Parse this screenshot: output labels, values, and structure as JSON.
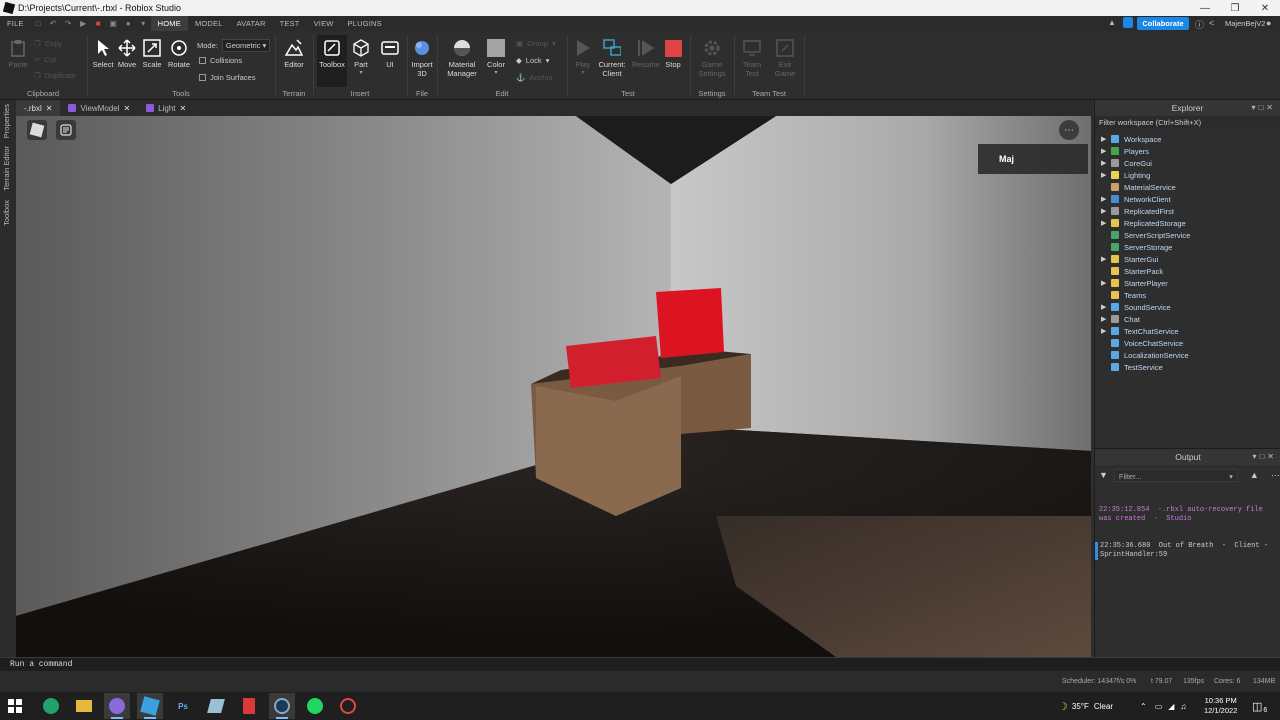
{
  "window": {
    "title": "D:\\Projects\\Current\\-.rbxl - Roblox Studio"
  },
  "menubar": {
    "items": [
      "FILE",
      "HOME",
      "MODEL",
      "AVATAR",
      "TEST",
      "VIEW",
      "PLUGINS"
    ],
    "active": "HOME",
    "collaborate": "Collaborate",
    "username": "MajenBejV2"
  },
  "ribbon": {
    "clipboard": {
      "paste": "Paste",
      "copy": "Copy",
      "cut": "Cut",
      "duplicate": "Duplicate",
      "label": "Clipboard"
    },
    "tools": {
      "select": "Select",
      "move": "Move",
      "scale": "Scale",
      "rotate": "Rotate",
      "mode_label": "Mode:",
      "mode_value": "Geometric",
      "collisions": "Collisions",
      "join_surfaces": "Join Surfaces",
      "label": "Tools"
    },
    "terrain": {
      "editor": "Editor",
      "label": "Terrain"
    },
    "insert": {
      "toolbox": "Toolbox",
      "part": "Part",
      "ui": "UI",
      "label": "Insert"
    },
    "file": {
      "import3d_1": "Import",
      "import3d_2": "3D",
      "label": "File"
    },
    "edit": {
      "material_1": "Material",
      "material_2": "Manager",
      "color": "Color",
      "group": "Group",
      "lock": "Lock",
      "anchor": "Anchor",
      "label": "Edit"
    },
    "test": {
      "play": "Play",
      "current_1": "Current:",
      "current_2": "Client",
      "resume": "Resume",
      "stop": "Stop",
      "label": "Test"
    },
    "settings": {
      "game_1": "Game",
      "game_2": "Settings",
      "label": "Settings"
    },
    "team_test": {
      "team_1": "Team",
      "team_2": "Test",
      "exit_1": "Exit",
      "exit_2": "Game",
      "label": "Team Test"
    }
  },
  "sidebar": {
    "items": [
      "Properties",
      "Terrain Editor",
      "Toolbox"
    ]
  },
  "tabs": [
    {
      "label": "-.rbxl"
    },
    {
      "label": "ViewModel"
    },
    {
      "label": "Light"
    }
  ],
  "viewport": {
    "player_label": "Maj"
  },
  "explorer": {
    "title": "Explorer",
    "filter": "Filter workspace (Ctrl+Shift+X)",
    "items": [
      {
        "name": "Workspace",
        "expand": true,
        "color": "#5aa9e6"
      },
      {
        "name": "Players",
        "expand": true,
        "color": "#4aa34a"
      },
      {
        "name": "CoreGui",
        "expand": true,
        "color": "#9a9a9a"
      },
      {
        "name": "Lighting",
        "expand": true,
        "color": "#e8d44d"
      },
      {
        "name": "MaterialService",
        "expand": false,
        "color": "#c8a06a"
      },
      {
        "name": "NetworkClient",
        "expand": true,
        "color": "#4a8ad8"
      },
      {
        "name": "ReplicatedFirst",
        "expand": true,
        "color": "#9a9a9a"
      },
      {
        "name": "ReplicatedStorage",
        "expand": true,
        "color": "#e8c44d"
      },
      {
        "name": "ServerScriptService",
        "expand": false,
        "color": "#4aa36a"
      },
      {
        "name": "ServerStorage",
        "expand": false,
        "color": "#4aa36a"
      },
      {
        "name": "StarterGui",
        "expand": true,
        "color": "#e8c44d"
      },
      {
        "name": "StarterPack",
        "expand": false,
        "color": "#e8c44d"
      },
      {
        "name": "StarterPlayer",
        "expand": true,
        "color": "#e8c44d"
      },
      {
        "name": "Teams",
        "expand": false,
        "color": "#e8c44d"
      },
      {
        "name": "SoundService",
        "expand": true,
        "color": "#5aa9e6"
      },
      {
        "name": "Chat",
        "expand": true,
        "color": "#9a9a9a"
      },
      {
        "name": "TextChatService",
        "expand": true,
        "color": "#5aa9e6"
      },
      {
        "name": "VoiceChatService",
        "expand": false,
        "color": "#5aa9e6"
      },
      {
        "name": "LocalizationService",
        "expand": false,
        "color": "#5aa9e6"
      },
      {
        "name": "TestService",
        "expand": false,
        "color": "#5aa9e6"
      }
    ]
  },
  "output": {
    "title": "Output",
    "filter": "Filter...",
    "lines": [
      {
        "text": "22:35:12.854  -.rbxl auto-recovery file was created  -  Studio",
        "color": "#c97ad8"
      },
      {
        "text": "22:35:36.680  Out of Breath  -  Client - SprintHandler:59",
        "color": "#cccccc"
      }
    ]
  },
  "command": {
    "placeholder": "Run a command"
  },
  "status": {
    "scheduler": "Scheduler: 14347f/s 0%",
    "t": "t 79.07",
    "fps": "135fps",
    "cores": "Cores: 6",
    "mem": "134MB"
  },
  "taskbar": {
    "weather_temp": "35°F",
    "weather_cond": "Clear",
    "time": "10:36 PM",
    "date": "12/1/2022",
    "notifications": "6"
  }
}
